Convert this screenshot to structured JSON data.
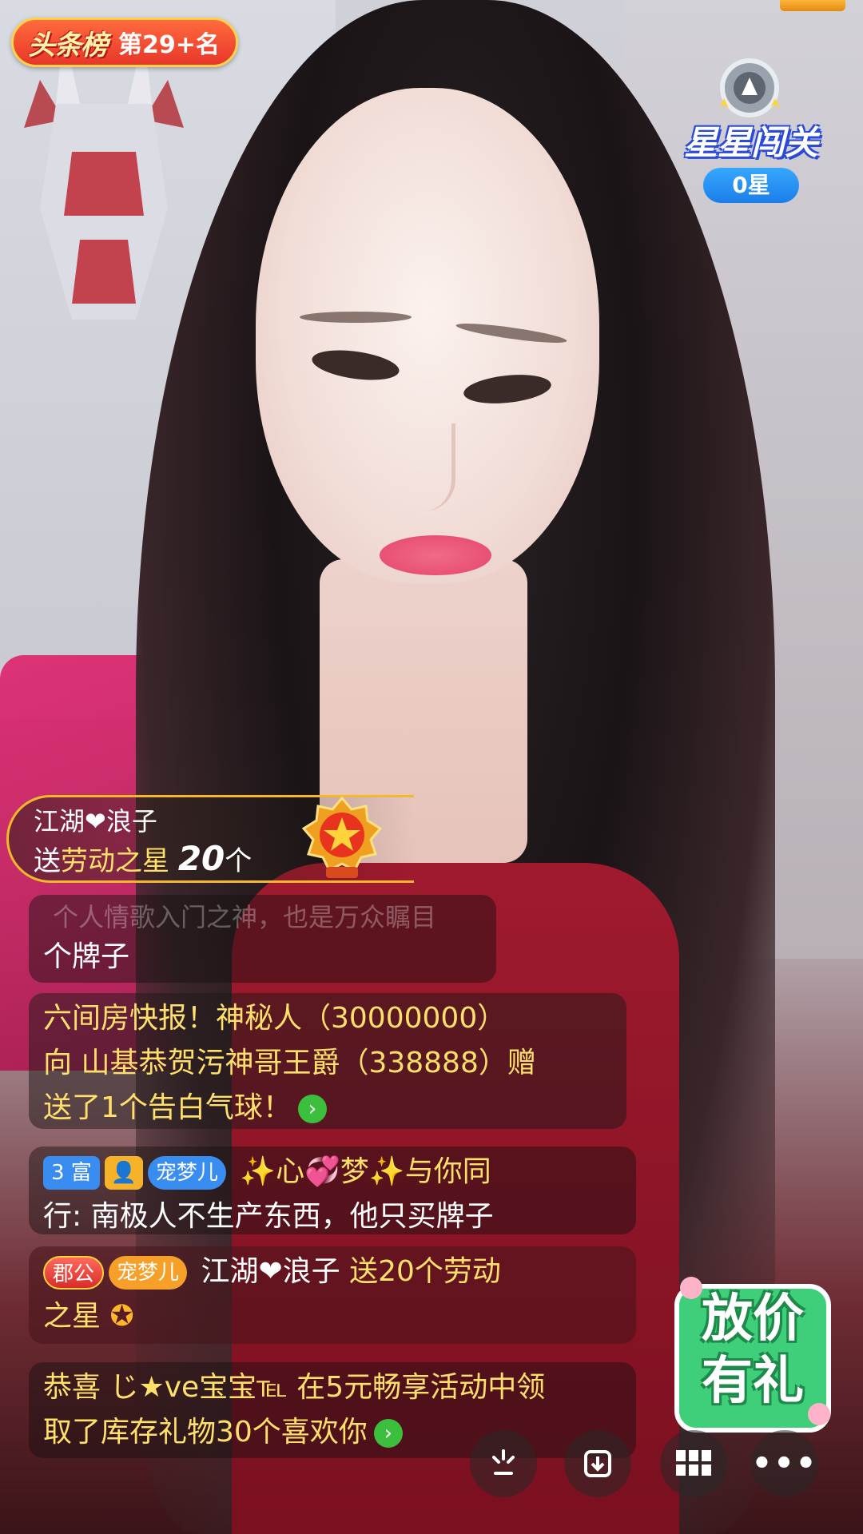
{
  "rank": {
    "logo": "头条榜",
    "position_text": "第29+名"
  },
  "star_challenge": {
    "title": "星星闯关",
    "count": "0星"
  },
  "gift_toast": {
    "sender": "江湖❤浪子",
    "verb": "送",
    "gift_name": "劳动之星",
    "quantity": "20",
    "unit": "个"
  },
  "chat": {
    "faded_line": "个人情歌入门之神，也是万众瞩目",
    "m0_text": "个牌子",
    "m1_text_a": " 六间房快报！神秘人（30000000）",
    "m1_text_b": "向  山基恭贺污神哥王爵（338888）赠",
    "m1_text_c": "送了1个告白气球！",
    "m2": {
      "level_badge": "3 富",
      "fan_badge": "宠梦儿",
      "user": "✨心💞梦✨与你同",
      "text": "行: 南极人不生产东西，他只买牌子"
    },
    "m3": {
      "duke_badge": "郡公",
      "fan_badge": "宠梦儿",
      "user": "江湖❤浪子",
      "text_a": " 送20个劳动",
      "text_b": "之星"
    },
    "m4": {
      "text_a": "恭喜 じ★ve宝宝℡  在5元畅享活动中领",
      "text_b": "取了库存礼物30个喜欢你"
    }
  },
  "promo": {
    "line1": "放价",
    "line2": "有礼"
  },
  "toolbar": {
    "share_glyph": "⁂",
    "more_glyph": "•••"
  }
}
